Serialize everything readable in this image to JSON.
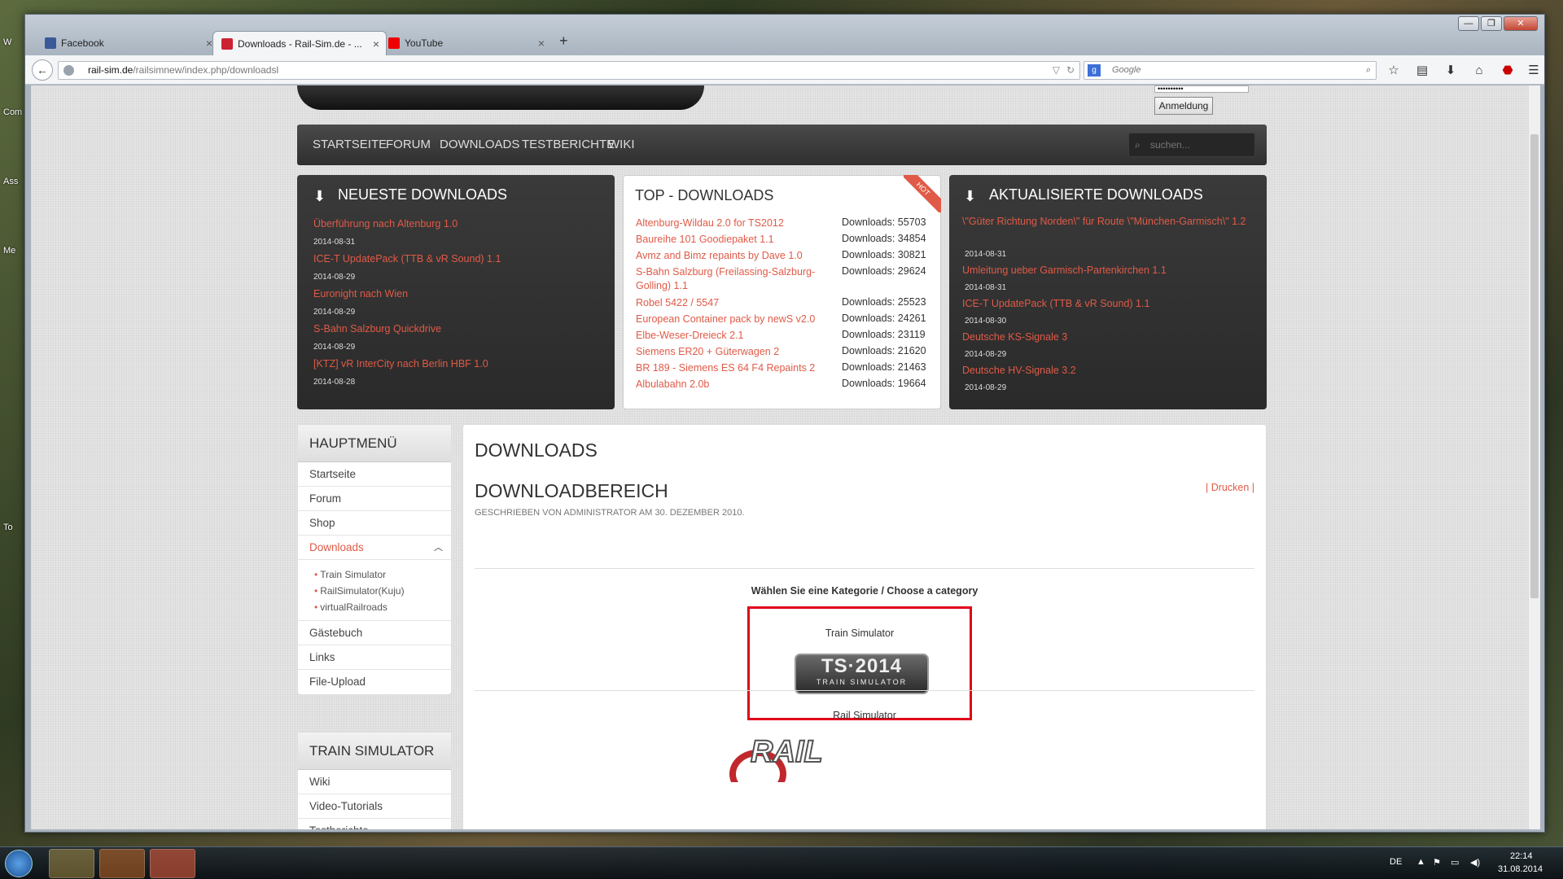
{
  "desktop": {
    "icons": [
      "W",
      "Com",
      "Ass",
      "Me",
      "To"
    ]
  },
  "browser": {
    "tabs": [
      {
        "label": "Facebook",
        "color": "#3b5998"
      },
      {
        "label": "Downloads - Rail-Sim.de - ...",
        "color": "#c23"
      },
      {
        "label": "YouTube",
        "color": "#e00"
      }
    ],
    "close_glyph": "×",
    "newtab_glyph": "+",
    "window_controls": {
      "minimize": "—",
      "maximize": "❐",
      "close": "✕"
    },
    "url_host": "rail-sim.de",
    "url_path": "/railsimnew/index.php/downloadsl",
    "search_placeholder": "Google",
    "icons": [
      "back-arrow-icon",
      "bookmark-star-icon",
      "clipboard-icon",
      "download-icon",
      "home-icon",
      "adblock-icon",
      "menu-icon"
    ]
  },
  "site": {
    "password_mask": "••••••••••",
    "login_button": "Anmeldung",
    "nav": [
      "STARTSEITE",
      "FORUM",
      "DOWNLOADS",
      "TESTBERICHTE",
      "WIKI"
    ],
    "search_placeholder": "suchen...",
    "newest": {
      "title": "NEUESTE DOWNLOADS",
      "items": [
        {
          "name": "Überführung nach Altenburg 1.0",
          "date": "2014-08-31"
        },
        {
          "name": "ICE-T UpdatePack (TTB & vR Sound) 1.1",
          "date": "2014-08-29"
        },
        {
          "name": "Euronight nach Wien",
          "date": "2014-08-29"
        },
        {
          "name": "S-Bahn Salzburg Quickdrive",
          "date": "2014-08-29"
        },
        {
          "name": "[KTZ] vR InterCity nach Berlin HBF 1.0",
          "date": "2014-08-28"
        }
      ]
    },
    "top": {
      "title": "TOP - DOWNLOADS",
      "badge": "HOT",
      "items": [
        {
          "name": "Altenburg-Wildau 2.0 for TS2012",
          "count": "Downloads: 55703"
        },
        {
          "name": "Baureihe 101 Goodiepaket 1.1",
          "count": "Downloads: 34854"
        },
        {
          "name": "Avmz and Bimz repaints by Dave 1.0",
          "count": "Downloads: 30821"
        },
        {
          "name": "S-Bahn Salzburg (Freilassing-Salzburg-Golling) 1.1",
          "count": "Downloads: 29624"
        },
        {
          "name": "Robel 5422 / 5547",
          "count": "Downloads: 25523"
        },
        {
          "name": "European Container pack by newS v2.0",
          "count": "Downloads: 24261"
        },
        {
          "name": "Elbe-Weser-Dreieck 2.1",
          "count": "Downloads: 23119"
        },
        {
          "name": "Siemens ER20 + Güterwagen 2",
          "count": "Downloads: 21620"
        },
        {
          "name": "BR 189 - Siemens ES 64 F4 Repaints 2",
          "count": "Downloads: 21463"
        },
        {
          "name": "Albulabahn 2.0b",
          "count": "Downloads: 19664"
        }
      ]
    },
    "updated": {
      "title": "AKTUALISIERTE DOWNLOADS",
      "items": [
        {
          "name": "\\\"Güter Richtung Norden\\\" für Route \\\"München-Garmisch\\\" 1.2",
          "date": "2014-08-31"
        },
        {
          "name": "Umleitung ueber Garmisch-Partenkirchen 1.1",
          "date": "2014-08-31"
        },
        {
          "name": "ICE-T UpdatePack (TTB & vR Sound) 1.1",
          "date": "2014-08-30"
        },
        {
          "name": "Deutsche KS-Signale 3",
          "date": "2014-08-29"
        },
        {
          "name": "Deutsche HV-Signale 3.2",
          "date": "2014-08-29"
        }
      ]
    },
    "mainmenu": {
      "title": "HAUPTMENÜ",
      "items": [
        "Startseite",
        "Forum",
        "Shop",
        "Downloads"
      ],
      "sub": [
        "Train Simulator",
        "RailSimulator(Kuju)",
        "virtualRailroads"
      ],
      "items2": [
        "Gästebuch",
        "Links",
        "File-Upload"
      ]
    },
    "tsmenu": {
      "title": "TRAIN SIMULATOR",
      "items": [
        "Wiki",
        "Video-Tutorials",
        "Testberichte"
      ]
    },
    "article": {
      "h1": "DOWNLOADS",
      "h2": "DOWNLOADBEREICH",
      "print": "| Drucken |",
      "meta": "GESCHRIEBEN VON ADMINISTRATOR AM 30. DEZEMBER 2010.",
      "choose": "Wählen Sie eine Kategorie / Choose a category",
      "cat1": "Train Simulator",
      "ts_logo_big": "TS·2014",
      "ts_logo_small": "TRAIN SIMULATOR",
      "cat2": "Rail Simulator",
      "rs_logo": "RAIL"
    }
  },
  "taskbar": {
    "lang": "DE",
    "time": "22:14",
    "date": "31.08.2014"
  }
}
